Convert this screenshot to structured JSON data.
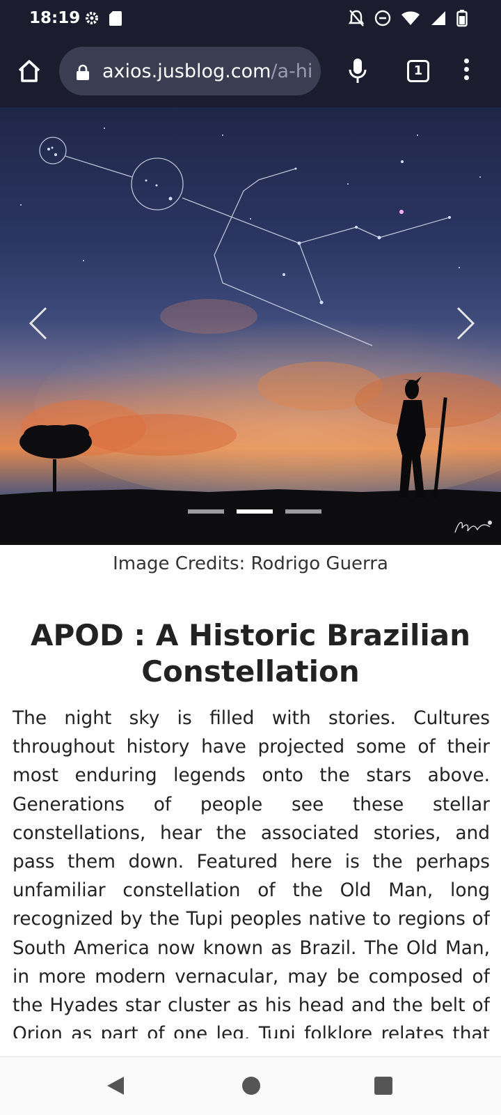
{
  "status_bar": {
    "time": "18:19",
    "left_icons": [
      "settings-icon",
      "sd-card-icon"
    ],
    "right_icons": [
      "notifications-off-icon",
      "do-not-disturb-icon",
      "wifi-icon",
      "signal-icon",
      "battery-icon"
    ]
  },
  "browser": {
    "url_domain": "axios.jusblog.com",
    "url_path": "/a-his",
    "tab_count": "1"
  },
  "hero": {
    "slide_count": 3,
    "active_slide": 2,
    "signature_text": "Rodrigo Guerra"
  },
  "article": {
    "image_caption": "Image Credits: Rodrigo Guerra",
    "title": "APOD : A Historic Brazilian Constellation",
    "body": "The night sky is filled with stories. Cultures throughout history have projected some of their most enduring legends onto the stars above. Generations of people see these stellar constellations, hear the associated stories, and pass them down. Featured here is the perhaps unfamiliar constellation of the Old Man, long recognized by the Tupi peoples native to regions of South America now known as Brazil. The Old Man, in more modern vernacular, may be composed of the Hyades star cluster as his head and the belt of Orion as part of one leg. Tupi folklore relates that the other leg was cut off by his unhappy wife, causing it to end at"
  },
  "colors": {
    "system_bar": "#1b1d2f",
    "url_bar": "#3b3e52",
    "text": "#222222"
  }
}
